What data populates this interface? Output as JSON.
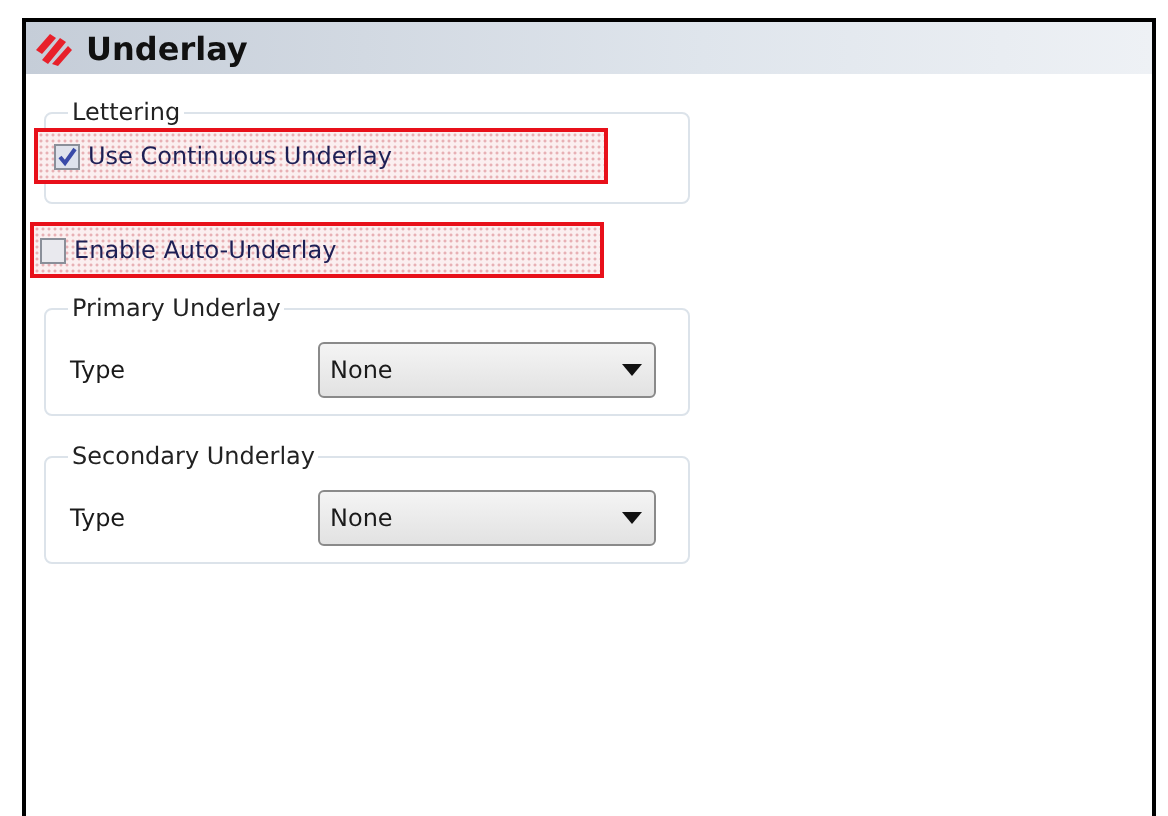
{
  "panel": {
    "title": "Underlay"
  },
  "lettering": {
    "title": "Lettering",
    "checkbox": {
      "label": "Use Continuous Underlay",
      "checked": true,
      "highlighted": true
    }
  },
  "auto_underlay": {
    "label": "Enable Auto-Underlay",
    "checked": false,
    "highlighted": true
  },
  "groups": [
    {
      "title": "Primary Underlay",
      "field_label": "Type",
      "value": "None"
    },
    {
      "title": "Secondary Underlay",
      "field_label": "Type",
      "value": "None"
    }
  ]
}
